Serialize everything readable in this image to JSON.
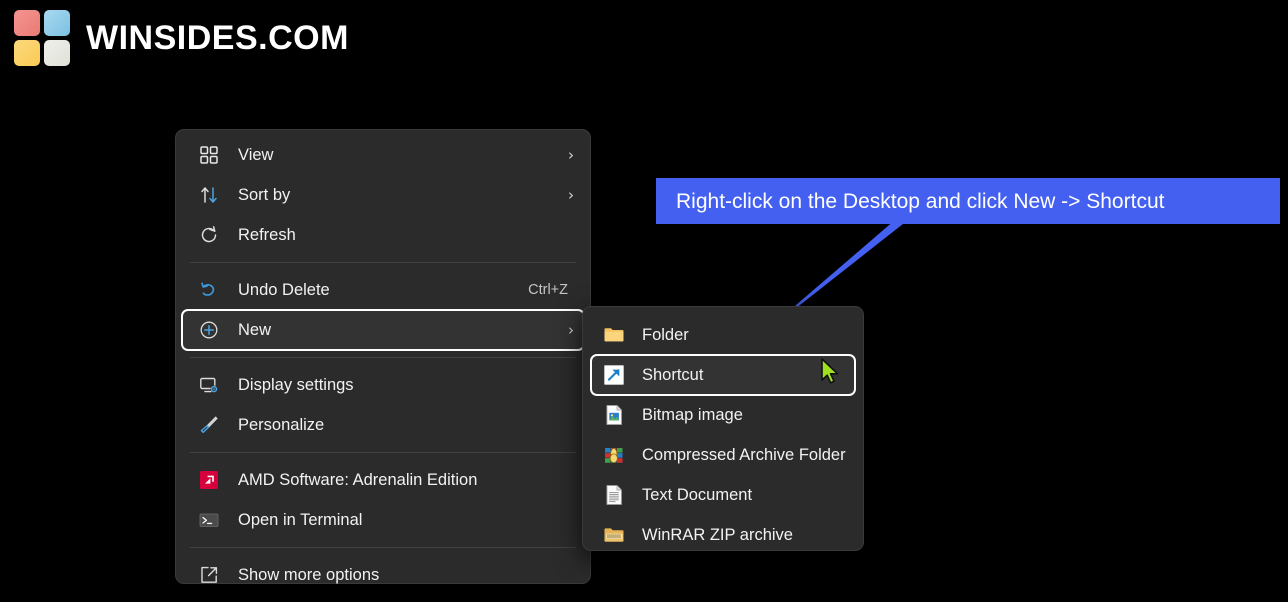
{
  "brand": {
    "name": "WINSIDES.COM",
    "logo_colors": [
      "#f08a85",
      "#8fcbe8",
      "#fcd66b",
      "#e6e8e0"
    ],
    "logo_icon": "four-squares-logo"
  },
  "callout": {
    "text": "Right-click on the Desktop and click New -> Shortcut",
    "color": "#4360f0",
    "text_color": "#ffffff"
  },
  "cursor": {
    "icon": "mouse-pointer-icon",
    "color": "#9ee020"
  },
  "main_menu": {
    "items": [
      {
        "label": "View",
        "icon": "grid-view-icon",
        "submenu": true,
        "accel": "",
        "selected": false
      },
      {
        "label": "Sort by",
        "icon": "sort-arrows-icon",
        "submenu": true,
        "accel": "",
        "selected": false
      },
      {
        "label": "Refresh",
        "icon": "refresh-icon",
        "submenu": false,
        "accel": "",
        "selected": false
      },
      {
        "separator": true
      },
      {
        "label": "Undo Delete",
        "icon": "undo-icon",
        "submenu": false,
        "accel": "Ctrl+Z",
        "selected": false
      },
      {
        "label": "New",
        "icon": "plus-circle-icon",
        "submenu": true,
        "accel": "",
        "selected": true
      },
      {
        "separator": true
      },
      {
        "label": "Display settings",
        "icon": "monitor-gear-icon",
        "submenu": false,
        "accel": "",
        "selected": false
      },
      {
        "label": "Personalize",
        "icon": "paintbrush-icon",
        "submenu": false,
        "accel": "",
        "selected": false
      },
      {
        "separator": true
      },
      {
        "label": "AMD Software: Adrenalin Edition",
        "icon": "amd-logo-icon",
        "submenu": false,
        "accel": "",
        "selected": false
      },
      {
        "label": "Open in Terminal",
        "icon": "terminal-icon",
        "submenu": false,
        "accel": "",
        "selected": false
      },
      {
        "separator": true
      },
      {
        "label": "Show more options",
        "icon": "show-more-options-icon",
        "submenu": false,
        "accel": "",
        "selected": false
      }
    ],
    "chevron": "›"
  },
  "sub_menu": {
    "items": [
      {
        "label": "Folder",
        "icon": "folder-icon",
        "selected": false
      },
      {
        "label": "Shortcut",
        "icon": "shortcut-arrow-icon",
        "selected": true
      },
      {
        "label": "Bitmap image",
        "icon": "bitmap-image-icon",
        "selected": false
      },
      {
        "label": "Compressed Archive Folder",
        "icon": "winrar-archive-icon",
        "selected": false
      },
      {
        "label": "Text Document",
        "icon": "text-document-icon",
        "selected": false
      },
      {
        "label": "WinRAR ZIP archive",
        "icon": "winrar-zip-icon",
        "selected": false
      }
    ]
  }
}
